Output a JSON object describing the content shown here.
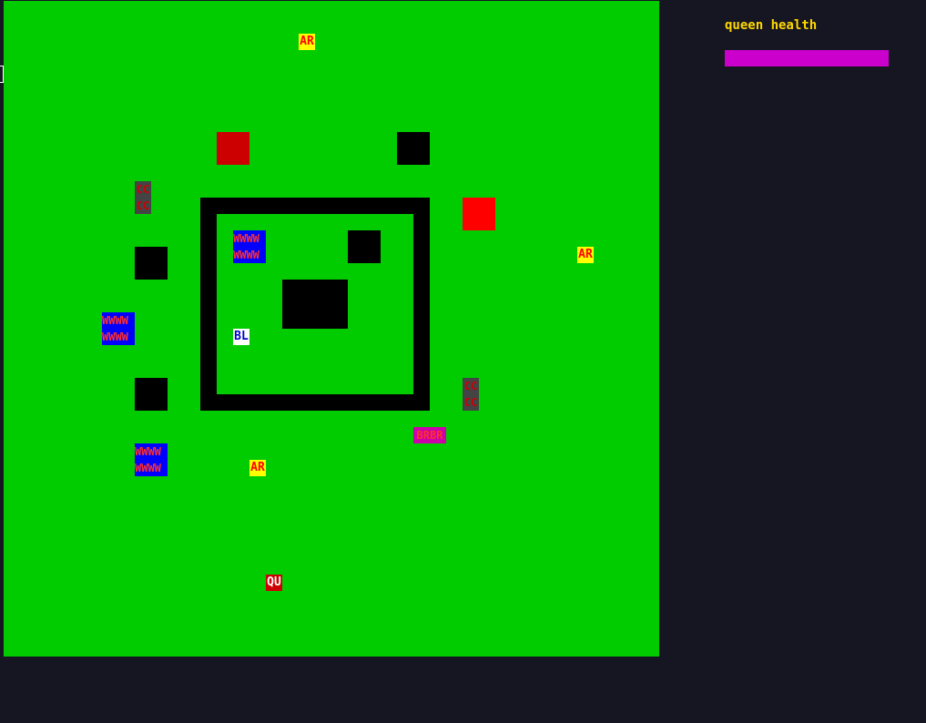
{
  "hud": {
    "queen_health_label": "queen health",
    "queen_health_fraction": 1.0,
    "queen_health_color": "#cc00cc"
  },
  "board": {
    "background_color": "#00cc00",
    "ar_labels": [
      "AR",
      "AR",
      "AR"
    ],
    "cc_label": "CC",
    "wwww_label": "WWWW",
    "bl_label": "BL",
    "qu_label": "QU",
    "brbr_label": "BRBR",
    "food_color_dark": "#cc0000",
    "food_color_bright": "#ff0000"
  }
}
